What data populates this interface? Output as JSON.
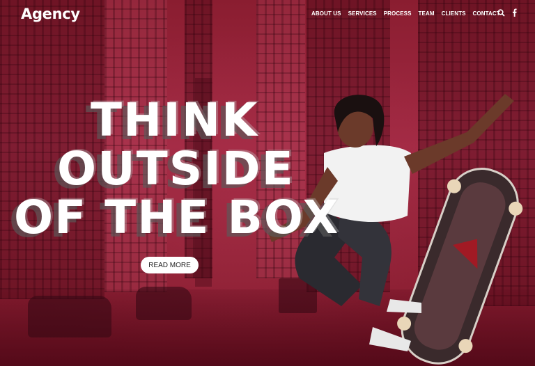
{
  "brand": {
    "name": "Agency"
  },
  "nav": {
    "items": [
      "ABOUT US",
      "SERVICES",
      "PROCESS",
      "TEAM",
      "CLIENTS",
      "CONTACT"
    ],
    "icons": [
      "search-icon",
      "facebook-icon"
    ]
  },
  "hero": {
    "headline": [
      "THINK",
      "OUTSIDE",
      "OF THE BOX"
    ],
    "cta_label": "READ MORE"
  },
  "colors": {
    "background": "#8e1f31",
    "text": "#ffffff",
    "button_bg": "#ffffff",
    "button_text": "#222222"
  }
}
